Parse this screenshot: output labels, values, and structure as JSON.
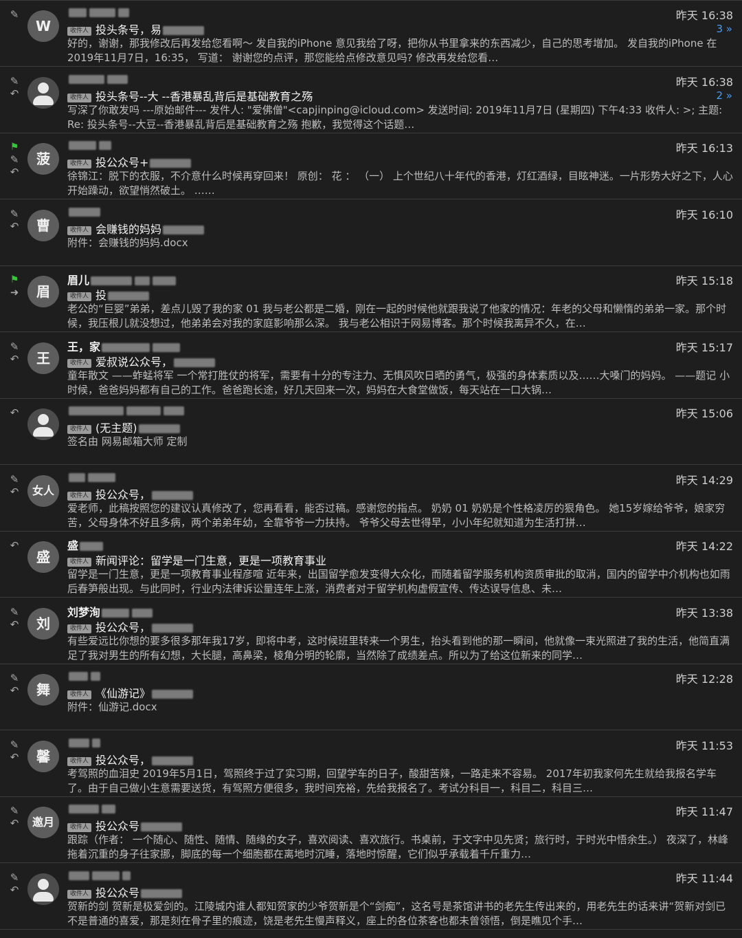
{
  "tag_label": "收件人",
  "emails": [
    {
      "avatar": "W",
      "sender": "",
      "subject": "投头条号，易",
      "time": "昨天 16:38",
      "count": "3 »",
      "icons": [
        "paperclip-icon"
      ],
      "preview": "好的，谢谢，那我修改后再发给您看啊～ 发自我的iPhone 意见我给了呀，把你从书里拿来的东西减少，自己的思考增加。 发自我的iPhone 在 2019年11月7日，16:35， 写道： 谢谢您的点评，那您能给点修改意见吗? 修改再发给您看…"
    },
    {
      "avatar": "",
      "sender": "",
      "subject": "投头条号--大 --香港暴乱背后是基础教育之殇",
      "time": "昨天 16:38",
      "count": "2 »",
      "icons": [
        "paperclip-icon",
        "reply-icon"
      ],
      "preview": "写深了你敢发吗 ---原始邮件--- 发件人: \"爱佛僧\"<capjinping@icloud.com> 发送时间: 2019年11月7日 (星期四) 下午4:33 收件人: >; 主题: Re: 投头条号--大豆--香港暴乱背后是基础教育之殇 抱歉，我觉得这个话题…"
    },
    {
      "avatar": "菠",
      "sender": "",
      "subject": "投公众号+",
      "time": "昨天 16:13",
      "count": "",
      "icons": [
        "flag-icon",
        "paperclip-icon",
        "reply-icon"
      ],
      "preview": "徐锦江：脱下的衣服，不介意什么时候再穿回来！ 原创： 花 ： （一） 上个世纪八十年代的香港，灯红酒绿，目眩神迷。一片形势大好之下，人心开始躁动，欲望悄然破土。 ……"
    },
    {
      "avatar": "曹",
      "sender": "",
      "subject": "会赚钱的妈妈",
      "time": "昨天 16:10",
      "count": "",
      "icons": [
        "paperclip-icon",
        "reply-icon"
      ],
      "preview": "附件：会赚钱的妈妈.docx"
    },
    {
      "avatar": "眉",
      "sender": "眉儿",
      "subject": "投",
      "time": "昨天 15:18",
      "count": "",
      "icons": [
        "flag-icon",
        "forward-icon"
      ],
      "preview": "老公的“巨婴”弟弟，差点儿毁了我的家 01 我与老公都是二婚，刚在一起的时候他就跟我说了他家的情况：年老的父母和懒惰的弟弟一家。那个时候，我压根儿就没想过，他弟弟会对我的家庭影响那么深。 我与老公相识于网易博客。那个时候我离异不久，在…"
    },
    {
      "avatar": "王",
      "sender": "王，家",
      "subject": "爱叔说公众号，",
      "time": "昨天 15:17",
      "count": "",
      "icons": [
        "paperclip-icon",
        "reply-icon"
      ],
      "preview": "童年散文 ——蚱蜢将军 一个常打胜仗的将军，需要有十分的专注力、无惧风吹日晒的勇气，极强的身体素质以及……大嗓门的妈妈。 ——题记 小时候，爸爸妈妈都有自己的工作。爸爸跑长途，好几天回来一次，妈妈在大食堂做饭，每天站在一口大锅…"
    },
    {
      "avatar": "",
      "sender": "",
      "subject": "(无主题)",
      "time": "昨天 15:06",
      "count": "",
      "icons": [
        "reply-icon"
      ],
      "preview": "签名由 网易邮箱大师 定制"
    },
    {
      "avatar": "女人",
      "sender": "",
      "subject": "投公众号，",
      "time": "昨天 14:29",
      "count": "",
      "icons": [
        "paperclip-icon",
        "reply-icon"
      ],
      "preview": "爱老师，此稿按照您的建议认真修改了，您再看看，能否过稿。感谢您的指点。 奶奶 01 奶奶是个性格凌厉的狠角色。 她15岁嫁给爷爷，娘家穷苦，父母身体不好且多病，两个弟弟年幼，全靠爷爷一力扶持。 爷爷父母去世得早，小小年纪就知道为生活打拼…"
    },
    {
      "avatar": "盛",
      "sender": "盛",
      "subject": "新闻评论：留学是一门生意，更是一项教育事业",
      "time": "昨天 14:22",
      "count": "",
      "icons": [
        "reply-icon"
      ],
      "preview": "留学是一门生意，更是一项教育事业程彦喧 近年来，出国留学愈发变得大众化，而随着留学服务机构资质审批的取消，国内的留学中介机构也如雨后春笋般出现。与此同时，行业内法律诉讼量连年上涨，消费者对于留学机构虚假宣传、传达误导信息、未…"
    },
    {
      "avatar": "刘",
      "sender": "刘梦洵",
      "subject": "投公众号，",
      "time": "昨天 13:38",
      "count": "",
      "icons": [
        "paperclip-icon",
        "reply-icon"
      ],
      "preview": "有些爱远比你想的要多很多那年我17岁，即将中考，这时候班里转来一个男生，抬头看到他的那一瞬间，他就像一束光照进了我的生活，他简直满足了我对男生的所有幻想，大长腿，高鼻梁，棱角分明的轮廓，当然除了成绩差点。所以为了给这位新来的同学…"
    },
    {
      "avatar": "舞",
      "sender": "",
      "subject": "《仙游记》",
      "time": "昨天 12:28",
      "count": "",
      "icons": [
        "paperclip-icon",
        "reply-icon"
      ],
      "preview": "附件：仙游记.docx"
    },
    {
      "avatar": "馨",
      "sender": "",
      "subject": "投公众号，",
      "time": "昨天 11:53",
      "count": "",
      "icons": [
        "paperclip-icon",
        "reply-icon"
      ],
      "preview": "考驾照的血泪史 2019年5月1日，驾照终于过了实习期，回望学车的日子，酸甜苦辣，一路走来不容易。 2017年初我家何先生就给我报名学车了。由于自己做小生意需要送货，有驾照方便很多，我时间充裕，先给我报名了。考试分科目一，科目二，科目三…"
    },
    {
      "avatar": "邀月",
      "sender": "",
      "subject": "投公众号",
      "time": "昨天 11:47",
      "count": "",
      "icons": [
        "paperclip-icon",
        "reply-icon"
      ],
      "preview": "跟踪（作者： 一个随心、随性、随情、随缘的女子，喜欢阅读、喜欢旅行。书桌前，于文字中见先贤；旅行时，于时光中悟余生。） 夜深了，林峰拖着沉重的身子往家挪，脚底的每一个细胞都在离地时沉睡，落地时惊醒，它们似乎承载着千斤重力…"
    },
    {
      "avatar": "",
      "sender": "",
      "subject": "投公众号",
      "time": "昨天 11:44",
      "count": "",
      "icons": [
        "paperclip-icon",
        "reply-icon"
      ],
      "preview": "贺新的剑 贺新是极爱剑的。江陵城内谁人都知贺家的少爷贺新是个“剑痴”，这名号是茶馆讲书的老先生传出来的，用老先生的话来讲“贺新对剑已不是普通的喜爱，那是刻在骨子里的痕迹，饶是老先生慢声释义，座上的各位茶客也都未曾领悟，倒是瞧见个手…"
    }
  ]
}
